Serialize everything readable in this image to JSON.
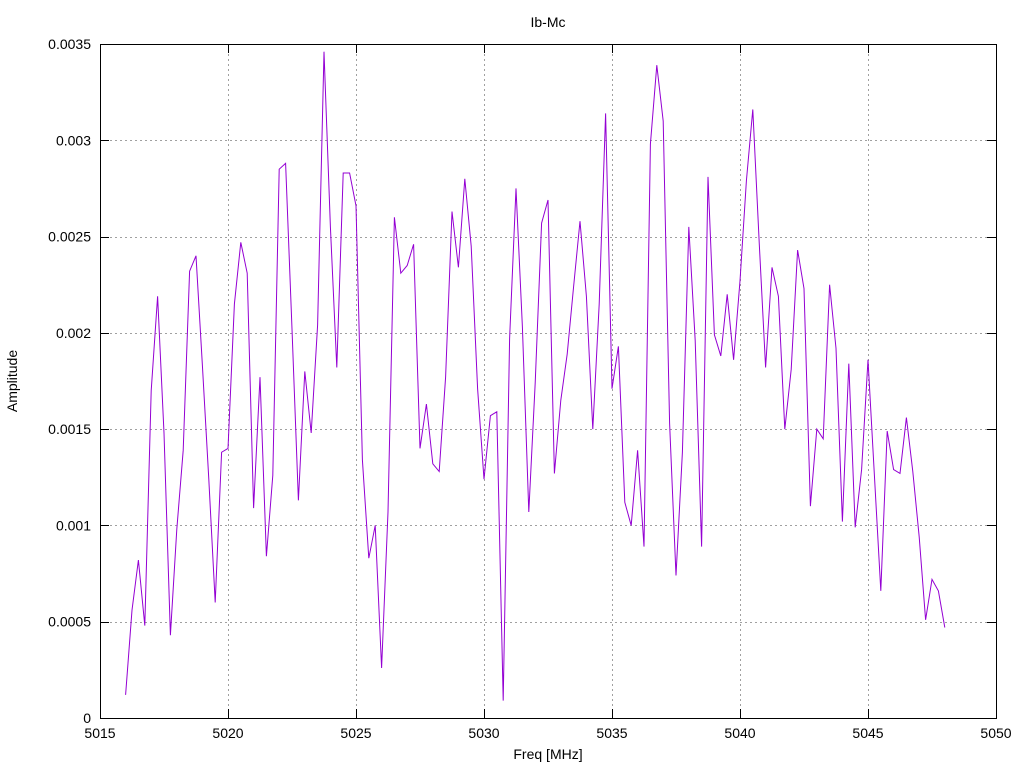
{
  "chart_data": {
    "type": "line",
    "title": "Ib-Mc",
    "xlabel": "Freq [MHz]",
    "ylabel": "Amplitude",
    "xlim": [
      5015,
      5050
    ],
    "ylim": [
      0,
      0.0035
    ],
    "xticks": [
      5015,
      5020,
      5025,
      5030,
      5035,
      5040,
      5045,
      5050
    ],
    "xtick_labels": [
      "5015",
      "5020",
      "5025",
      "5030",
      "5035",
      "5040",
      "5045",
      "5050"
    ],
    "yticks": [
      0,
      0.0005,
      0.001,
      0.0015,
      0.002,
      0.0025,
      0.003,
      0.0035
    ],
    "ytick_labels": [
      "0",
      "0.0005",
      "0.001",
      "0.0015",
      "0.002",
      "0.0025",
      "0.003",
      "0.0035"
    ],
    "grid": true,
    "series": [
      {
        "color": "#9400d3",
        "x": [
          5016.0,
          5016.25,
          5016.5,
          5016.75,
          5017.0,
          5017.25,
          5017.5,
          5017.75,
          5018.0,
          5018.25,
          5018.5,
          5018.75,
          5019.0,
          5019.25,
          5019.5,
          5019.75,
          5020.0,
          5020.25,
          5020.5,
          5020.75,
          5021.0,
          5021.25,
          5021.5,
          5021.75,
          5022.0,
          5022.25,
          5022.5,
          5022.75,
          5023.0,
          5023.25,
          5023.5,
          5023.75,
          5024.0,
          5024.25,
          5024.5,
          5024.75,
          5025.0,
          5025.25,
          5025.5,
          5025.75,
          5026.0,
          5026.25,
          5026.5,
          5026.75,
          5027.0,
          5027.25,
          5027.5,
          5027.75,
          5028.0,
          5028.25,
          5028.5,
          5028.75,
          5029.0,
          5029.25,
          5029.5,
          5029.75,
          5030.0,
          5030.25,
          5030.5,
          5030.75,
          5031.0,
          5031.25,
          5031.5,
          5031.75,
          5032.0,
          5032.25,
          5032.5,
          5032.75,
          5033.0,
          5033.25,
          5033.5,
          5033.75,
          5034.0,
          5034.25,
          5034.5,
          5034.75,
          5035.0,
          5035.25,
          5035.5,
          5035.75,
          5036.0,
          5036.25,
          5036.5,
          5036.75,
          5037.0,
          5037.25,
          5037.5,
          5037.75,
          5038.0,
          5038.25,
          5038.5,
          5038.75,
          5039.0,
          5039.25,
          5039.5,
          5039.75,
          5040.0,
          5040.25,
          5040.5,
          5040.75,
          5041.0,
          5041.25,
          5041.5,
          5041.75,
          5042.0,
          5042.25,
          5042.5,
          5042.75,
          5043.0,
          5043.25,
          5043.5,
          5043.75,
          5044.0,
          5044.25,
          5044.5,
          5044.75,
          5045.0,
          5045.25,
          5045.5,
          5045.75,
          5046.0,
          5046.25,
          5046.5,
          5046.75,
          5047.0,
          5047.25,
          5047.5,
          5047.75,
          5048.0
        ],
        "y": [
          0.00012,
          0.00056,
          0.00082,
          0.00048,
          0.0017,
          0.00219,
          0.00148,
          0.00043,
          0.00098,
          0.00139,
          0.00232,
          0.0024,
          0.00183,
          0.00124,
          0.0006,
          0.00138,
          0.0014,
          0.00215,
          0.00247,
          0.00231,
          0.00109,
          0.00177,
          0.00084,
          0.00126,
          0.00285,
          0.00288,
          0.00202,
          0.00113,
          0.0018,
          0.00148,
          0.00204,
          0.00346,
          0.00255,
          0.00182,
          0.00283,
          0.00283,
          0.00266,
          0.00134,
          0.00083,
          0.001,
          0.00026,
          0.00107,
          0.0026,
          0.00231,
          0.00235,
          0.00246,
          0.0014,
          0.00163,
          0.00132,
          0.00128,
          0.00177,
          0.00263,
          0.00234,
          0.0028,
          0.00245,
          0.00171,
          0.00124,
          0.00157,
          0.00159,
          9e-05,
          0.00197,
          0.00275,
          0.00203,
          0.00107,
          0.00174,
          0.00257,
          0.00269,
          0.00127,
          0.00165,
          0.00189,
          0.00224,
          0.00258,
          0.00219,
          0.0015,
          0.00215,
          0.00314,
          0.00171,
          0.00193,
          0.00112,
          0.001,
          0.00139,
          0.00089,
          0.00298,
          0.00339,
          0.0031,
          0.00153,
          0.00074,
          0.00138,
          0.00255,
          0.00196,
          0.00089,
          0.00281,
          0.00199,
          0.00188,
          0.0022,
          0.00186,
          0.00227,
          0.00279,
          0.00316,
          0.00247,
          0.00182,
          0.00234,
          0.00219,
          0.0015,
          0.00181,
          0.00243,
          0.00223,
          0.0011,
          0.0015,
          0.00145,
          0.00225,
          0.00192,
          0.00102,
          0.00184,
          0.00099,
          0.00129,
          0.00186,
          0.00126,
          0.00066,
          0.00149,
          0.00129,
          0.00127,
          0.00156,
          0.00128,
          0.00094,
          0.00051,
          0.00072,
          0.00066,
          0.00047
        ]
      }
    ]
  }
}
